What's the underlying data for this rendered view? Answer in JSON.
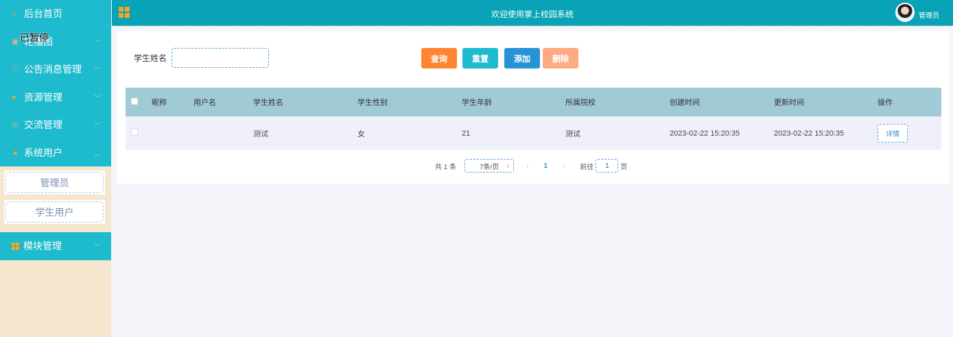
{
  "sidebar": {
    "items": [
      {
        "label": "后台首页",
        "icon": "home-icon",
        "color": "#f6a623"
      },
      {
        "label": "轮播图",
        "icon": "image-icon",
        "color": "#c8b890"
      },
      {
        "label": "公告消息管理",
        "icon": "info-icon",
        "color": "#c8b890"
      },
      {
        "label": "资源管理",
        "icon": "location-icon",
        "color": "#f6a623"
      },
      {
        "label": "交流管理",
        "icon": "chat-icon",
        "color": "#c8b890"
      },
      {
        "label": "系统用户",
        "icon": "user-icon",
        "color": "#f6a623"
      }
    ],
    "sub": [
      "管理员",
      "学生用户"
    ],
    "last": {
      "label": "模块管理",
      "icon": "grid-icon"
    },
    "overlay": "已暂停"
  },
  "header": {
    "title": "欢迎使用掌上校园系统",
    "user": "管理员"
  },
  "search": {
    "label": "学生姓名",
    "value": ""
  },
  "buttons": {
    "query": "查询",
    "reset": "重置",
    "add": "添加",
    "delete": "删除"
  },
  "colors": {
    "query": "#ff8533",
    "reset": "#1ebacd",
    "add": "#2693d6",
    "delete": "#ffaa85"
  },
  "table": {
    "headers": [
      "昵称",
      "用户名",
      "学生姓名",
      "学生性别",
      "学生年龄",
      "所属院校",
      "创建时间",
      "更新时间",
      "操作"
    ],
    "rows": [
      {
        "cells": [
          "",
          "",
          "测试",
          "女",
          "21",
          "测试",
          "2023-02-22 15:20:35",
          "2023-02-22 15:20:35"
        ],
        "action": "详情"
      }
    ]
  },
  "pager": {
    "total": "共 1 条",
    "size": "7条/页",
    "page": "1",
    "goto": "前往",
    "goto_value": "1",
    "unit": "页"
  }
}
